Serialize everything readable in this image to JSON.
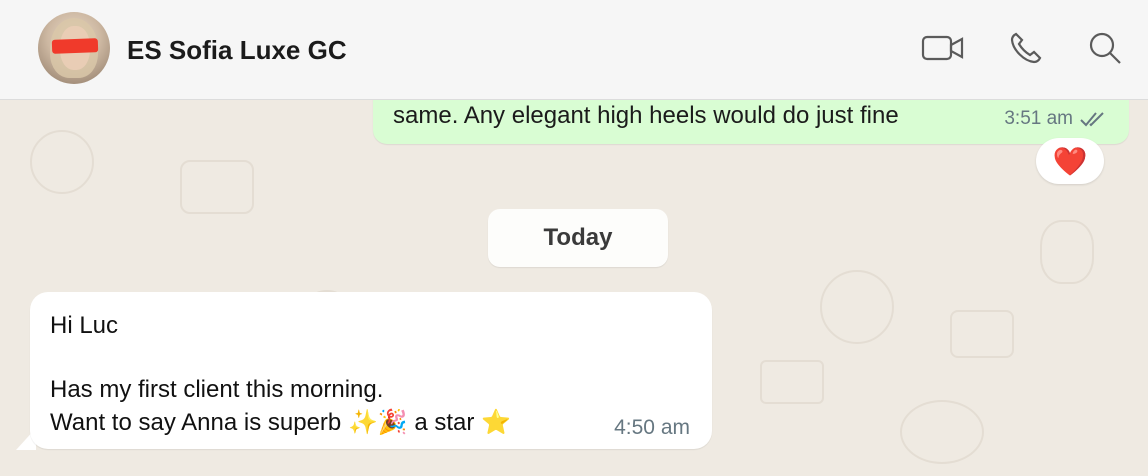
{
  "header": {
    "chat_title": "ES Sofia Luxe GC",
    "icons": [
      "video-call-icon",
      "voice-call-icon",
      "search-icon"
    ]
  },
  "messages": [
    {
      "direction": "outgoing",
      "text": "same. Any elegant high heels would do just fine",
      "time": "3:51 am",
      "status": "read",
      "reaction": "❤️"
    },
    {
      "type": "date_separator",
      "label": "Today"
    },
    {
      "direction": "incoming",
      "lines": [
        "Hi Luc",
        "",
        "Has my first client this morning.",
        "Want to say Anna is superb ✨🎉 a star ⭐"
      ],
      "time": "4:50 am"
    }
  ],
  "colors": {
    "header_bg": "#f6f6f6",
    "chat_bg": "#efeae2",
    "outgoing_bubble": "#d9fdd3",
    "incoming_bubble": "#ffffff",
    "read_ticks": "#667781",
    "redaction": "#f03a2b"
  }
}
